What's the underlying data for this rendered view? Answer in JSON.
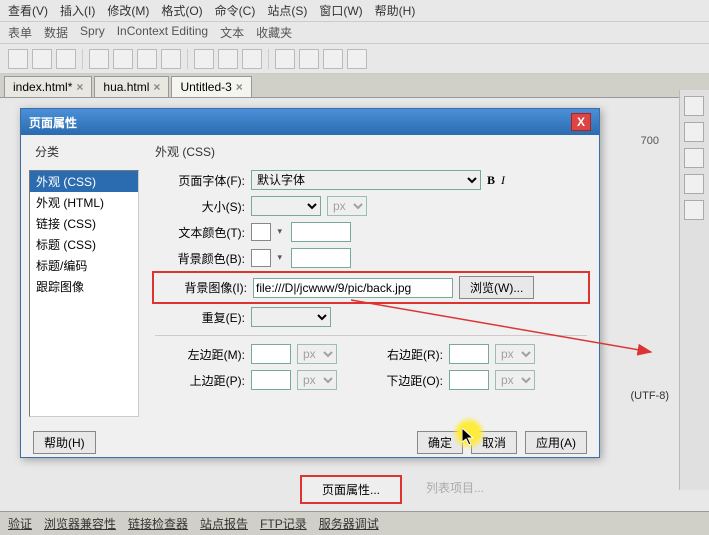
{
  "menubar": [
    "查看(V)",
    "插入(I)",
    "修改(M)",
    "格式(O)",
    "命令(C)",
    "站点(S)",
    "窗口(W)",
    "帮助(H)"
  ],
  "secondbar": [
    "表单",
    "数据",
    "Spry",
    "InContext Editing",
    "文本",
    "收藏夹"
  ],
  "tabs": [
    {
      "label": "index.html*",
      "active": false
    },
    {
      "label": "hua.html",
      "active": false
    },
    {
      "label": "Untitled-3",
      "active": true
    }
  ],
  "dialog": {
    "title": "页面属性",
    "sidebar_label": "分类",
    "sidebar_items": [
      "外观 (CSS)",
      "外观 (HTML)",
      "链接 (CSS)",
      "标题 (CSS)",
      "标题/编码",
      "跟踪图像"
    ],
    "sidebar_selected": 0,
    "form_title": "外观 (CSS)",
    "font_label": "页面字体(F):",
    "font_value": "默认字体",
    "size_label": "大小(S):",
    "size_unit": "px",
    "textcolor_label": "文本颜色(T):",
    "bgcolor_label": "背景颜色(B):",
    "bgimage_label": "背景图像(I):",
    "bgimage_value": "file:///D|/jcwww/9/pic/back.jpg",
    "browse_label": "浏览(W)...",
    "repeat_label": "重复(E):",
    "marginL_label": "左边距(M):",
    "marginR_label": "右边距(R):",
    "marginT_label": "上边距(P):",
    "marginB_label": "下边距(O):",
    "margin_unit": "px",
    "help_btn": "帮助(H)",
    "ok_btn": "确定",
    "cancel_btn": "取消",
    "apply_btn": "应用(A)"
  },
  "bottom": {
    "page_prop": "页面属性...",
    "list_item": "列表项目..."
  },
  "statusbar": [
    "验证",
    "浏览器兼容性",
    "链接检查器",
    "站点报告",
    "FTP记录",
    "服务器调试"
  ],
  "ruler_mark": "700",
  "encoding": "(UTF-8)"
}
